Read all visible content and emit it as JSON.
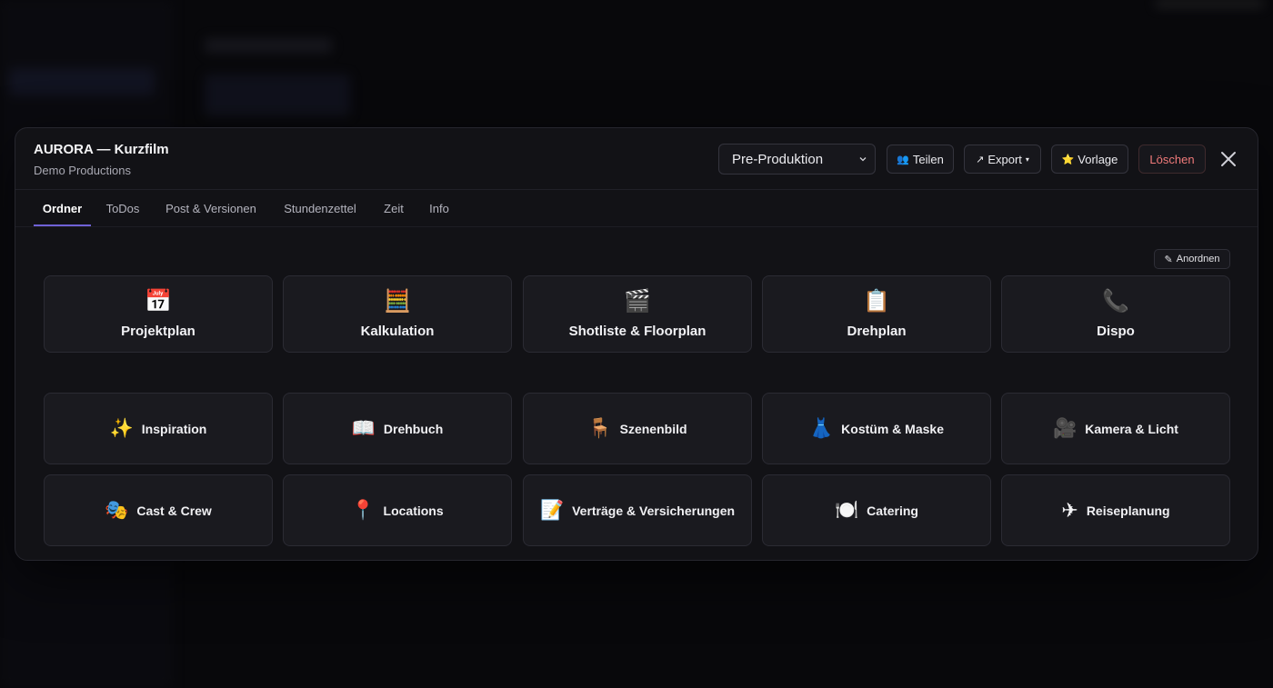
{
  "project": {
    "title": "AURORA — Kurzfilm",
    "company": "Demo Productions"
  },
  "header": {
    "phase_value": "Pre-Produktion",
    "share_label": "Teilen",
    "share_icon": "👥",
    "export_label": "Export",
    "export_icon": "↗",
    "export_caret": "▾",
    "template_label": "Vorlage",
    "template_icon": "⭐",
    "delete_label": "Löschen"
  },
  "tabs": [
    {
      "label": "Ordner",
      "active": true
    },
    {
      "label": "ToDos"
    },
    {
      "label": "Post & Versionen"
    },
    {
      "label": "Stundenzettel"
    },
    {
      "label": "Zeit"
    },
    {
      "label": "Info"
    }
  ],
  "arrange_label": "Anordnen",
  "arrange_icon": "✎",
  "primary_folders": [
    {
      "label": "Projektplan",
      "icon": "📅",
      "icon_name": "calendar-icon"
    },
    {
      "label": "Kalkulation",
      "icon": "🧮",
      "icon_name": "abacus-icon"
    },
    {
      "label": "Shotliste & Floorplan",
      "icon": "🎬",
      "icon_name": "clapperboard-icon"
    },
    {
      "label": "Drehplan",
      "icon": "📋",
      "icon_name": "clipboard-icon"
    },
    {
      "label": "Dispo",
      "icon": "📞",
      "icon_name": "phone-icon"
    }
  ],
  "secondary_folders": [
    {
      "label": "Inspiration",
      "icon": "✨",
      "icon_name": "sparkles-icon"
    },
    {
      "label": "Drehbuch",
      "icon": "📖",
      "icon_name": "open-book-icon"
    },
    {
      "label": "Szenenbild",
      "icon": "🪑",
      "icon_name": "chair-icon"
    },
    {
      "label": "Kostüm & Maske",
      "icon": "👗",
      "icon_name": "dress-icon"
    },
    {
      "label": "Kamera & Licht",
      "icon": "🎥",
      "icon_name": "movie-camera-icon"
    },
    {
      "label": "Cast & Crew",
      "icon": "🎭",
      "icon_name": "theater-masks-icon"
    },
    {
      "label": "Locations",
      "icon": "📍",
      "icon_name": "pin-icon"
    },
    {
      "label": "Verträge & Versicherungen",
      "icon": "📝",
      "icon_name": "memo-icon"
    },
    {
      "label": "Catering",
      "icon": "🍽️",
      "icon_name": "plate-icon"
    },
    {
      "label": "Reiseplanung",
      "icon": "✈",
      "icon_name": "airplane-icon"
    }
  ],
  "colors": {
    "accent": "#6f62d6",
    "danger": "#f07a7a",
    "card_bg": "#1a1a1f",
    "modal_bg": "#121216"
  }
}
